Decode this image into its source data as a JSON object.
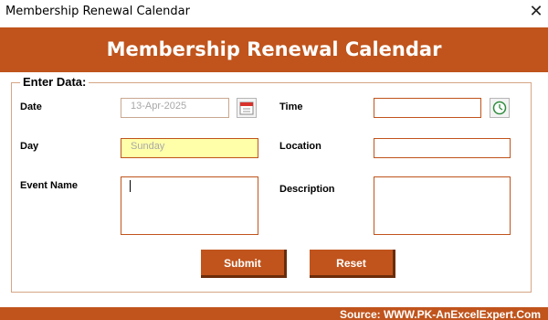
{
  "window": {
    "title": "Membership Renewal Calendar"
  },
  "banner": {
    "heading": "Membership Renewal Calendar"
  },
  "form": {
    "group_label": "Enter Data:",
    "date": {
      "label": "Date",
      "value": "13-Apr-2025"
    },
    "day": {
      "label": "Day",
      "value": "Sunday"
    },
    "event_name": {
      "label": "Event Name",
      "value": ""
    },
    "time": {
      "label": "Time",
      "value": ""
    },
    "location": {
      "label": "Location",
      "value": ""
    },
    "description": {
      "label": "Description",
      "value": ""
    }
  },
  "buttons": {
    "submit": "Submit",
    "reset": "Reset"
  },
  "footer": {
    "source": "Source: WWW.PK-AnExcelExpert.Com"
  },
  "colors": {
    "accent": "#c0541c",
    "day_field_bg": "#ffffa9",
    "panel_border": "#d5a585"
  },
  "icons": {
    "close": "close-icon",
    "date_picker": "calendar-icon",
    "time_picker": "clock-icon"
  }
}
